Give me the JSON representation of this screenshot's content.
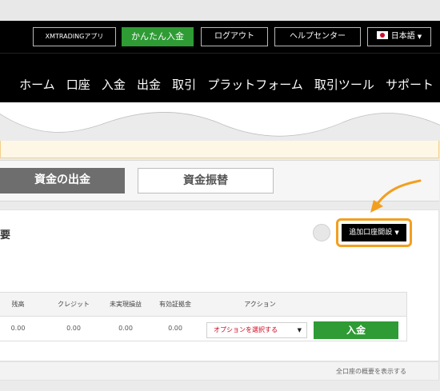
{
  "topbar": {
    "app_label": "XMTRADINGアプリ",
    "deposit_label": "かんたん入金",
    "logout_label": "ログアウト",
    "help_label": "ヘルプセンター",
    "language_label": "日本語"
  },
  "nav": {
    "items": [
      "ホーム",
      "口座",
      "入金",
      "出金",
      "取引",
      "プラットフォーム",
      "取引ツール",
      "サポート"
    ]
  },
  "tabs": {
    "withdraw_label": "資金の出金",
    "transfer_label": "資金振替"
  },
  "account_card": {
    "title": "要",
    "open_account_label": "追加口座開設",
    "table": {
      "headers": [
        "残高",
        "クレジット",
        "未実現損益",
        "有効証拠金",
        "アクション"
      ],
      "row": [
        "0.00",
        "0.00",
        "0.00",
        "0.00"
      ],
      "action_select_label": "オプションを選択する",
      "deposit_button_label": "入金"
    },
    "summary_link": "全口座の概要を表示する"
  },
  "colors": {
    "topbar_bg": "#000000",
    "green": "#2e9b35",
    "highlight_orange": "#f29f1f",
    "select_text": "#d0021b"
  }
}
